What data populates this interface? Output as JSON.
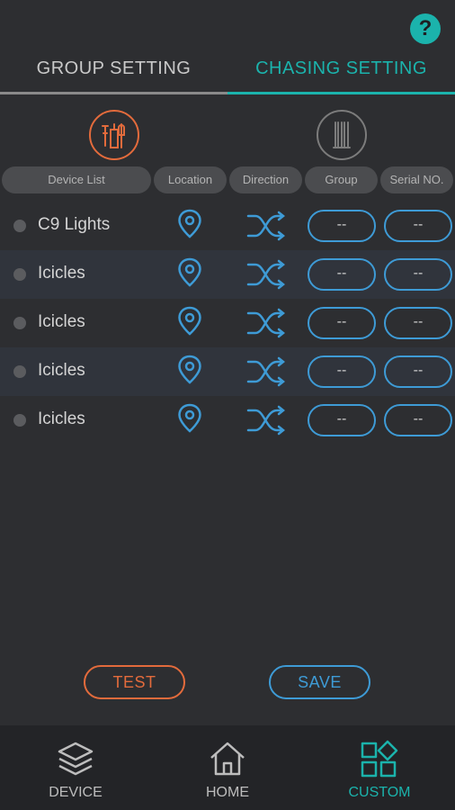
{
  "help": {
    "symbol": "?"
  },
  "tabs": {
    "group_setting": "GROUP SETTING",
    "chasing_setting": "CHASING SETTING",
    "active": "chasing_setting"
  },
  "mode_icons": [
    "tools-icon",
    "tubes-icon"
  ],
  "columns": [
    "Device List",
    "Location",
    "Direction",
    "Group",
    "Serial NO."
  ],
  "rows": [
    {
      "name": "C9 Lights",
      "group": "--",
      "serial": "--"
    },
    {
      "name": "Icicles",
      "group": "--",
      "serial": "--"
    },
    {
      "name": "Icicles",
      "group": "--",
      "serial": "--"
    },
    {
      "name": "Icicles",
      "group": "--",
      "serial": "--"
    },
    {
      "name": "Icicles",
      "group": "--",
      "serial": "--"
    }
  ],
  "actions": {
    "test": "TEST",
    "save": "SAVE"
  },
  "nav": {
    "device": "DEVICE",
    "home": "HOME",
    "custom": "CUSTOM",
    "active": "custom"
  },
  "colors": {
    "accent_teal": "#1bb3ac",
    "accent_orange": "#e36b3c",
    "accent_blue": "#3e9bd6"
  }
}
